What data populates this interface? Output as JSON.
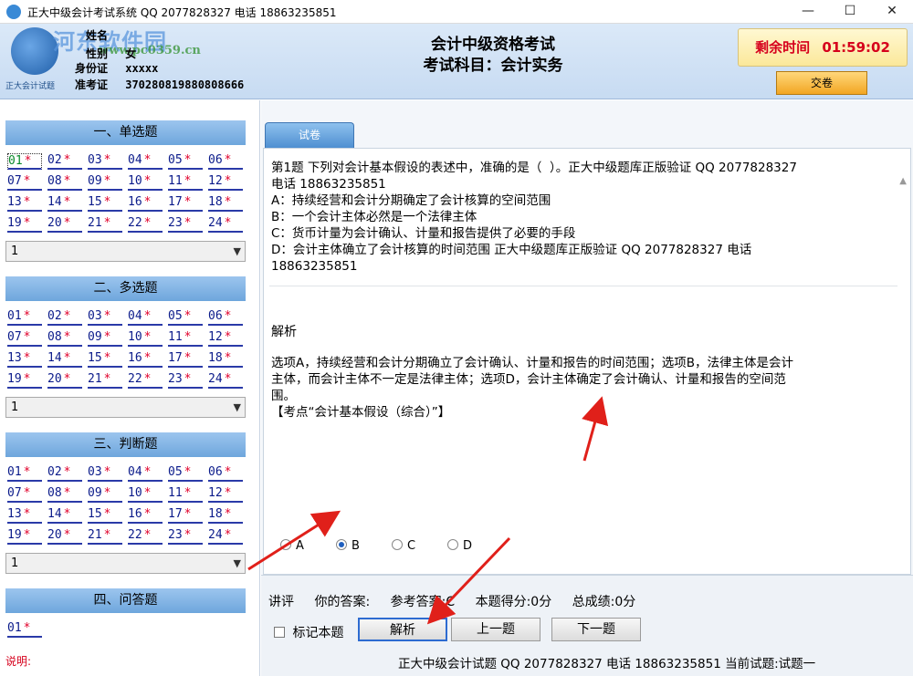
{
  "window": {
    "title": "正大中级会计考试系统 QQ 2077828327 电话 18863235851",
    "min_glyph": "—",
    "max_glyph": "☐",
    "close_glyph": "✕"
  },
  "header": {
    "logo_text": "正大会计试题",
    "watermark": "河东软件园",
    "watermark_url": "www.pc0359.cn",
    "name_label": "姓名",
    "name_value": "",
    "gender_label": "性别",
    "gender_value": "女",
    "id_label": "身份证",
    "id_value": "xxxxx",
    "ticket_label": "准考证",
    "ticket_value": "370280819880808666",
    "exam_title_line1": "会计中级资格考试",
    "exam_title_line2": "考试科目：会计实务",
    "timer_label": "剩余时间",
    "timer_value": "01:59:02",
    "submit_label": "交卷"
  },
  "sections": [
    {
      "title": "一、单选题",
      "questions": [
        "01",
        "02",
        "03",
        "04",
        "05",
        "06",
        "07",
        "08",
        "09",
        "10",
        "11",
        "12",
        "13",
        "14",
        "15",
        "16",
        "17",
        "18",
        "19",
        "20",
        "21",
        "22",
        "23",
        "24"
      ],
      "select_value": "1"
    },
    {
      "title": "二、多选题",
      "questions": [
        "01",
        "02",
        "03",
        "04",
        "05",
        "06",
        "07",
        "08",
        "09",
        "10",
        "11",
        "12",
        "13",
        "14",
        "15",
        "16",
        "17",
        "18",
        "19",
        "20",
        "21",
        "22",
        "23",
        "24"
      ],
      "select_value": "1"
    },
    {
      "title": "三、判断题",
      "questions": [
        "01",
        "02",
        "03",
        "04",
        "05",
        "06",
        "07",
        "08",
        "09",
        "10",
        "11",
        "12",
        "13",
        "14",
        "15",
        "16",
        "17",
        "18",
        "19",
        "20",
        "21",
        "22",
        "23",
        "24"
      ],
      "select_value": "1"
    },
    {
      "title": "四、问答题",
      "questions": [
        "01"
      ]
    }
  ],
  "star": "*",
  "current_question": "01",
  "note_label": "说明:",
  "main": {
    "tab_label": "试卷",
    "question_text": "第1题 下列对会计基本假设的表述中，准确的是（  ）。正大中级题库正版验证 QQ 2077828327\n电话 18863235851\nA：持续经营和会计分期确定了会计核算的空间范围\nB：一个会计主体必然是一个法律主体\nC：货币计量为会计确认、计量和报告提供了必要的手段\nD：会计主体确立了会计核算的时间范围 正大中级题库正版验证 QQ 2077828327 电话\n18863235851",
    "analysis_title": "解析",
    "analysis_text": "选项A，持续经营和会计分期确立了会计确认、计量和报告的时间范围；选项B，法律主体是会计\n主体，而会计主体不一定是法律主体；选项D，会计主体确定了会计确认、计量和报告的空间范\n围。\n【考点“会计基本假设（综合）”】",
    "options": [
      {
        "label": "A",
        "selected": false
      },
      {
        "label": "B",
        "selected": true
      },
      {
        "label": "C",
        "selected": false
      },
      {
        "label": "D",
        "selected": false
      }
    ]
  },
  "bottom": {
    "lecture_label": "讲评",
    "your_answer": "你的答案:",
    "ref_answer": "参考答案:C",
    "question_score": "本题得分:0分",
    "total_score": "总成绩:0分",
    "mark_label": "标记本题",
    "analysis_btn": "解析",
    "prev_btn": "上一题",
    "next_btn": "下一题",
    "footer": "正大中级会计试题   QQ 2077828327   电话 18863235851 当前试题:试题一"
  },
  "colors": {
    "arrow": "#e0201a",
    "timer": "#d6001c",
    "section_header": "#7fb3e6",
    "question_link": "#0a1a8a"
  }
}
